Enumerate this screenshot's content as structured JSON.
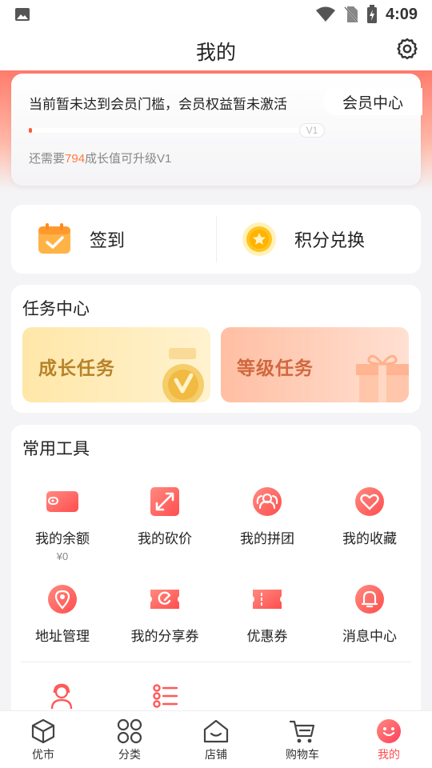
{
  "status_bar": {
    "time": "4:09"
  },
  "header": {
    "title": "我的"
  },
  "member": {
    "message": "当前暂未达到会员门槛，会员权益暂未激活",
    "center_button": "会员中心",
    "level": "V1",
    "progress_fraction": 0.01,
    "upgrade_prefix": "还需要",
    "upgrade_value": "794",
    "upgrade_suffix": "成长值可升级V1"
  },
  "quick": {
    "checkin": "签到",
    "points": "积分兑换"
  },
  "tasks": {
    "title": "任务中心",
    "growth": "成长任务",
    "level": "等级任务"
  },
  "tools": {
    "title": "常用工具",
    "items": [
      {
        "name": "我的余额",
        "sub": "¥0",
        "icon": "wallet-icon"
      },
      {
        "name": "我的砍价",
        "icon": "bargain-icon"
      },
      {
        "name": "我的拼团",
        "icon": "group-buy-icon"
      },
      {
        "name": "我的收藏",
        "icon": "heart-icon"
      },
      {
        "name": "地址管理",
        "icon": "location-icon"
      },
      {
        "name": "我的分享券",
        "icon": "share-coupon-icon"
      },
      {
        "name": "优惠券",
        "icon": "coupon-icon"
      },
      {
        "name": "消息中心",
        "icon": "bell-icon"
      }
    ]
  },
  "tabs": [
    {
      "label": "优市",
      "icon": "box-icon"
    },
    {
      "label": "分类",
      "icon": "category-icon"
    },
    {
      "label": "店铺",
      "icon": "store-icon"
    },
    {
      "label": "购物车",
      "icon": "cart-icon"
    },
    {
      "label": "我的",
      "icon": "profile-icon",
      "active": true
    }
  ],
  "colors": {
    "accent": "#ff4e4e",
    "highlight": "#ff7a3a",
    "gold": "#b7822a"
  }
}
